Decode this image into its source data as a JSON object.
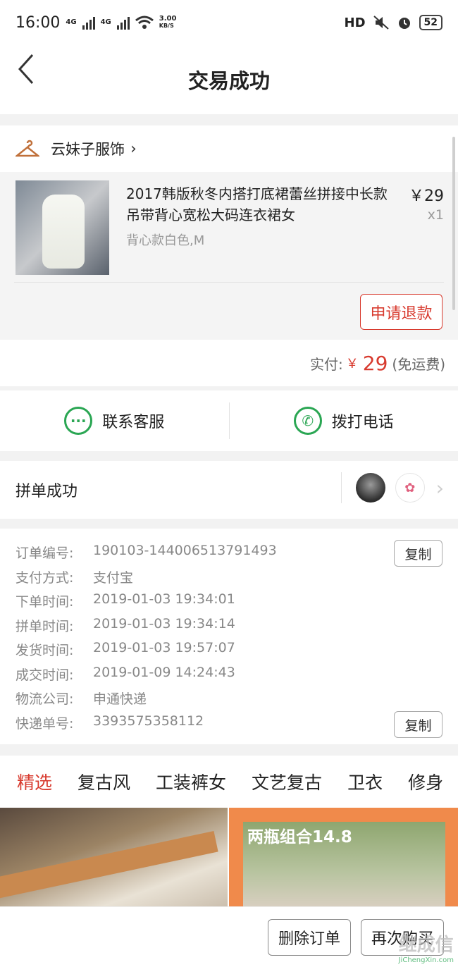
{
  "status": {
    "time": "16:00",
    "net1": "4G",
    "net2": "4G",
    "speed_val": "3.00",
    "speed_unit": "KB/S",
    "hd": "HD",
    "battery": "52"
  },
  "nav": {
    "title": "交易成功"
  },
  "shop": {
    "name": "云妹子服饰"
  },
  "product": {
    "name": "2017韩版秋冬内搭打底裙蕾丝拼接中长款吊带背心宽松大码连衣裙女",
    "price": "￥29",
    "qty": "x1",
    "spec": "背心款白色,M",
    "refund_label": "申请退款"
  },
  "paid": {
    "label": "实付:",
    "currency": "￥",
    "amount": "29",
    "shipping": "(免运费)"
  },
  "contact": {
    "service_label": "联系客服",
    "phone_label": "拨打电话"
  },
  "group": {
    "label": "拼单成功"
  },
  "order": {
    "rows": [
      {
        "k": "订单编号:",
        "v": "190103-144006513791493"
      },
      {
        "k": "支付方式:",
        "v": "支付宝"
      },
      {
        "k": "下单时间:",
        "v": "2019-01-03 19:34:01"
      },
      {
        "k": "拼单时间:",
        "v": "2019-01-03 19:34:14"
      },
      {
        "k": "发货时间:",
        "v": "2019-01-03 19:57:07"
      },
      {
        "k": "成交时间:",
        "v": "2019-01-09 14:24:43"
      },
      {
        "k": "物流公司:",
        "v": "申通快递"
      },
      {
        "k": "快递单号:",
        "v": "3393575358112"
      }
    ],
    "copy_label": "复制"
  },
  "tabs": [
    "精选",
    "复古风",
    "工装裤女",
    "文艺复古",
    "卫衣",
    "修身"
  ],
  "promo": {
    "text": "两瓶组合14.8"
  },
  "actions": {
    "delete_label": "删除订单",
    "rebuy_label": "再次购买"
  },
  "watermark": {
    "text": "继成信",
    "url": "JiChengXin.com"
  },
  "colors": {
    "accent": "#d83b2f",
    "green": "#2aa653"
  }
}
